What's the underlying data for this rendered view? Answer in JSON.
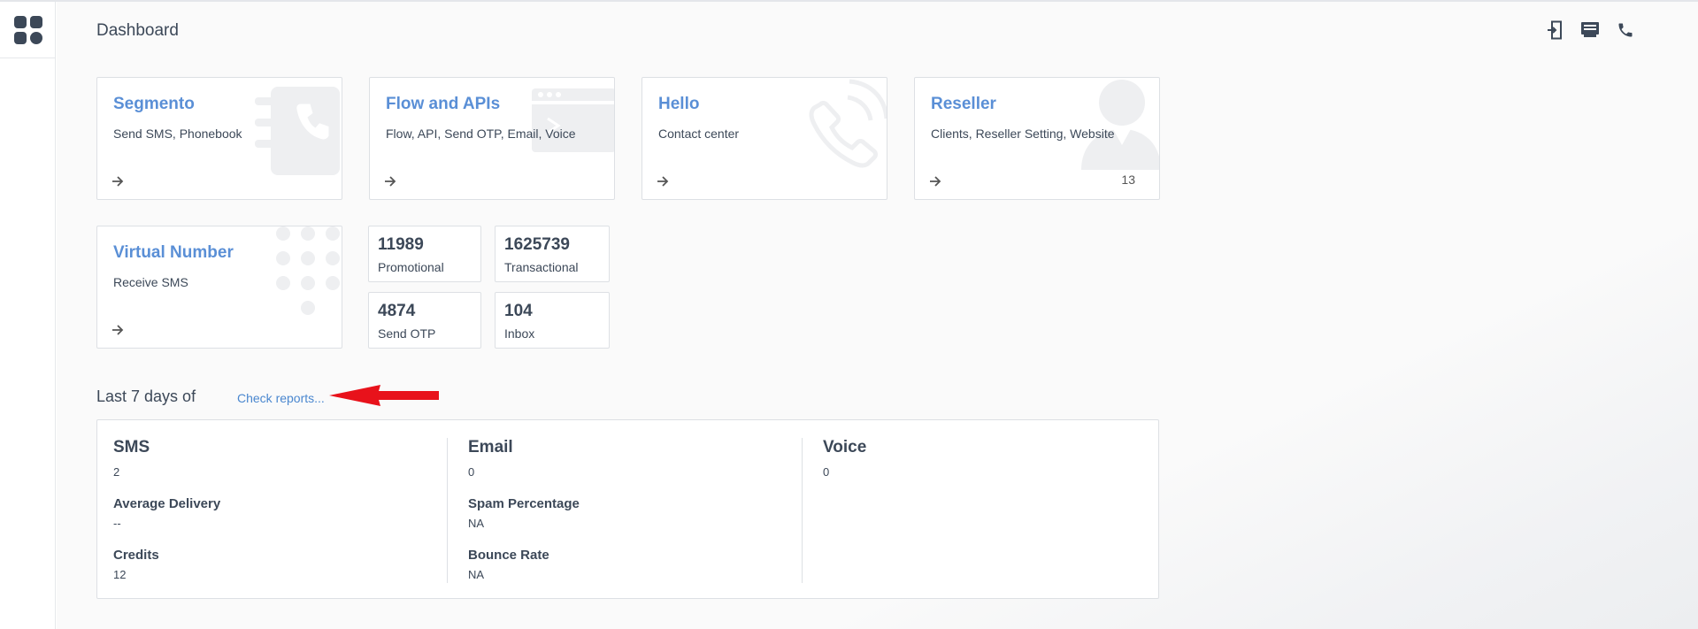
{
  "header": {
    "title": "Dashboard",
    "icons": [
      "logout-icon",
      "billing-icon",
      "phone-icon"
    ]
  },
  "sidebar": {
    "logo_icon": "apps-grid-icon"
  },
  "cards": [
    {
      "title": "Segmento",
      "subtitle": "Send SMS, Phonebook",
      "icon": "contacts-book-icon"
    },
    {
      "title": "Flow and APIs",
      "subtitle": "Flow, API, Send OTP, Email, Voice",
      "icon": "browser-window-icon"
    },
    {
      "title": "Hello",
      "subtitle": "Contact center",
      "icon": "phone-ringing-icon"
    },
    {
      "title": "Reseller",
      "subtitle": "Clients, Reseller Setting, Website",
      "icon": "user-silhouette-icon",
      "count": "13"
    },
    {
      "title": "Virtual Number",
      "subtitle": "Receive SMS",
      "icon": "dialpad-icon"
    }
  ],
  "stats": [
    {
      "value": "11989",
      "label": "Promotional"
    },
    {
      "value": "1625739",
      "label": "Transactional"
    },
    {
      "value": "4874",
      "label": "Send OTP"
    },
    {
      "value": "104",
      "label": "Inbox"
    }
  ],
  "reports": {
    "heading": "Last 7 days of",
    "link": "Check reports...",
    "annotation_color": "#e8121b",
    "sms": {
      "title": "SMS",
      "value": "2",
      "avg_label": "Average Delivery",
      "avg_value": "--",
      "credits_label": "Credits",
      "credits_value": "12"
    },
    "email": {
      "title": "Email",
      "value": "0",
      "spam_label": "Spam Percentage",
      "spam_value": "NA",
      "bounce_label": "Bounce Rate",
      "bounce_value": "NA"
    },
    "voice": {
      "title": "Voice",
      "value": "0"
    }
  },
  "colors": {
    "accent": "#5a8fd6",
    "link": "#4a87cf",
    "text": "#3c4858",
    "icon_dark": "#3c4858",
    "card_bg_icon": "#eeeff1"
  }
}
